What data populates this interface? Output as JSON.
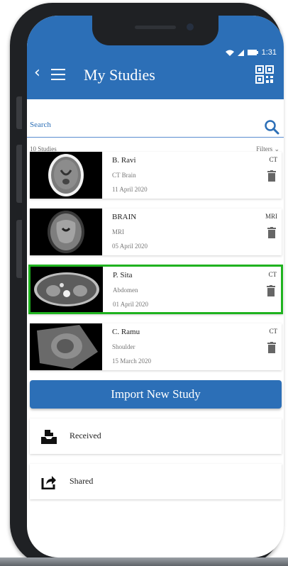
{
  "status_bar": {
    "time": "1:31"
  },
  "appbar": {
    "title": "My Studies"
  },
  "search": {
    "placeholder": "Search"
  },
  "list_header": {
    "count": "10 Studies",
    "filters": "Filters"
  },
  "studies": [
    {
      "name": "B. Ravi",
      "part": "CT Brain",
      "date": "11 April 2020",
      "modality": "CT",
      "selected": false
    },
    {
      "name": "BRAIN",
      "part": "MRI",
      "date": "05 April 2020",
      "modality": "MRI",
      "selected": false
    },
    {
      "name": "P. Sita",
      "part": "Abdomen",
      "date": "01 April 2020",
      "modality": "CT",
      "selected": true
    },
    {
      "name": "C. Ramu",
      "part": "Shoulder",
      "date": "15 March 2020",
      "modality": "CT",
      "selected": false
    }
  ],
  "import_button": {
    "label": "Import New Study"
  },
  "received": {
    "label": "Received",
    "icon": "inbox-icon"
  },
  "shared": {
    "label": "Shared",
    "icon": "share-icon"
  },
  "colors": {
    "primary": "#2c6fb7",
    "selected_border": "#1fb31f"
  }
}
